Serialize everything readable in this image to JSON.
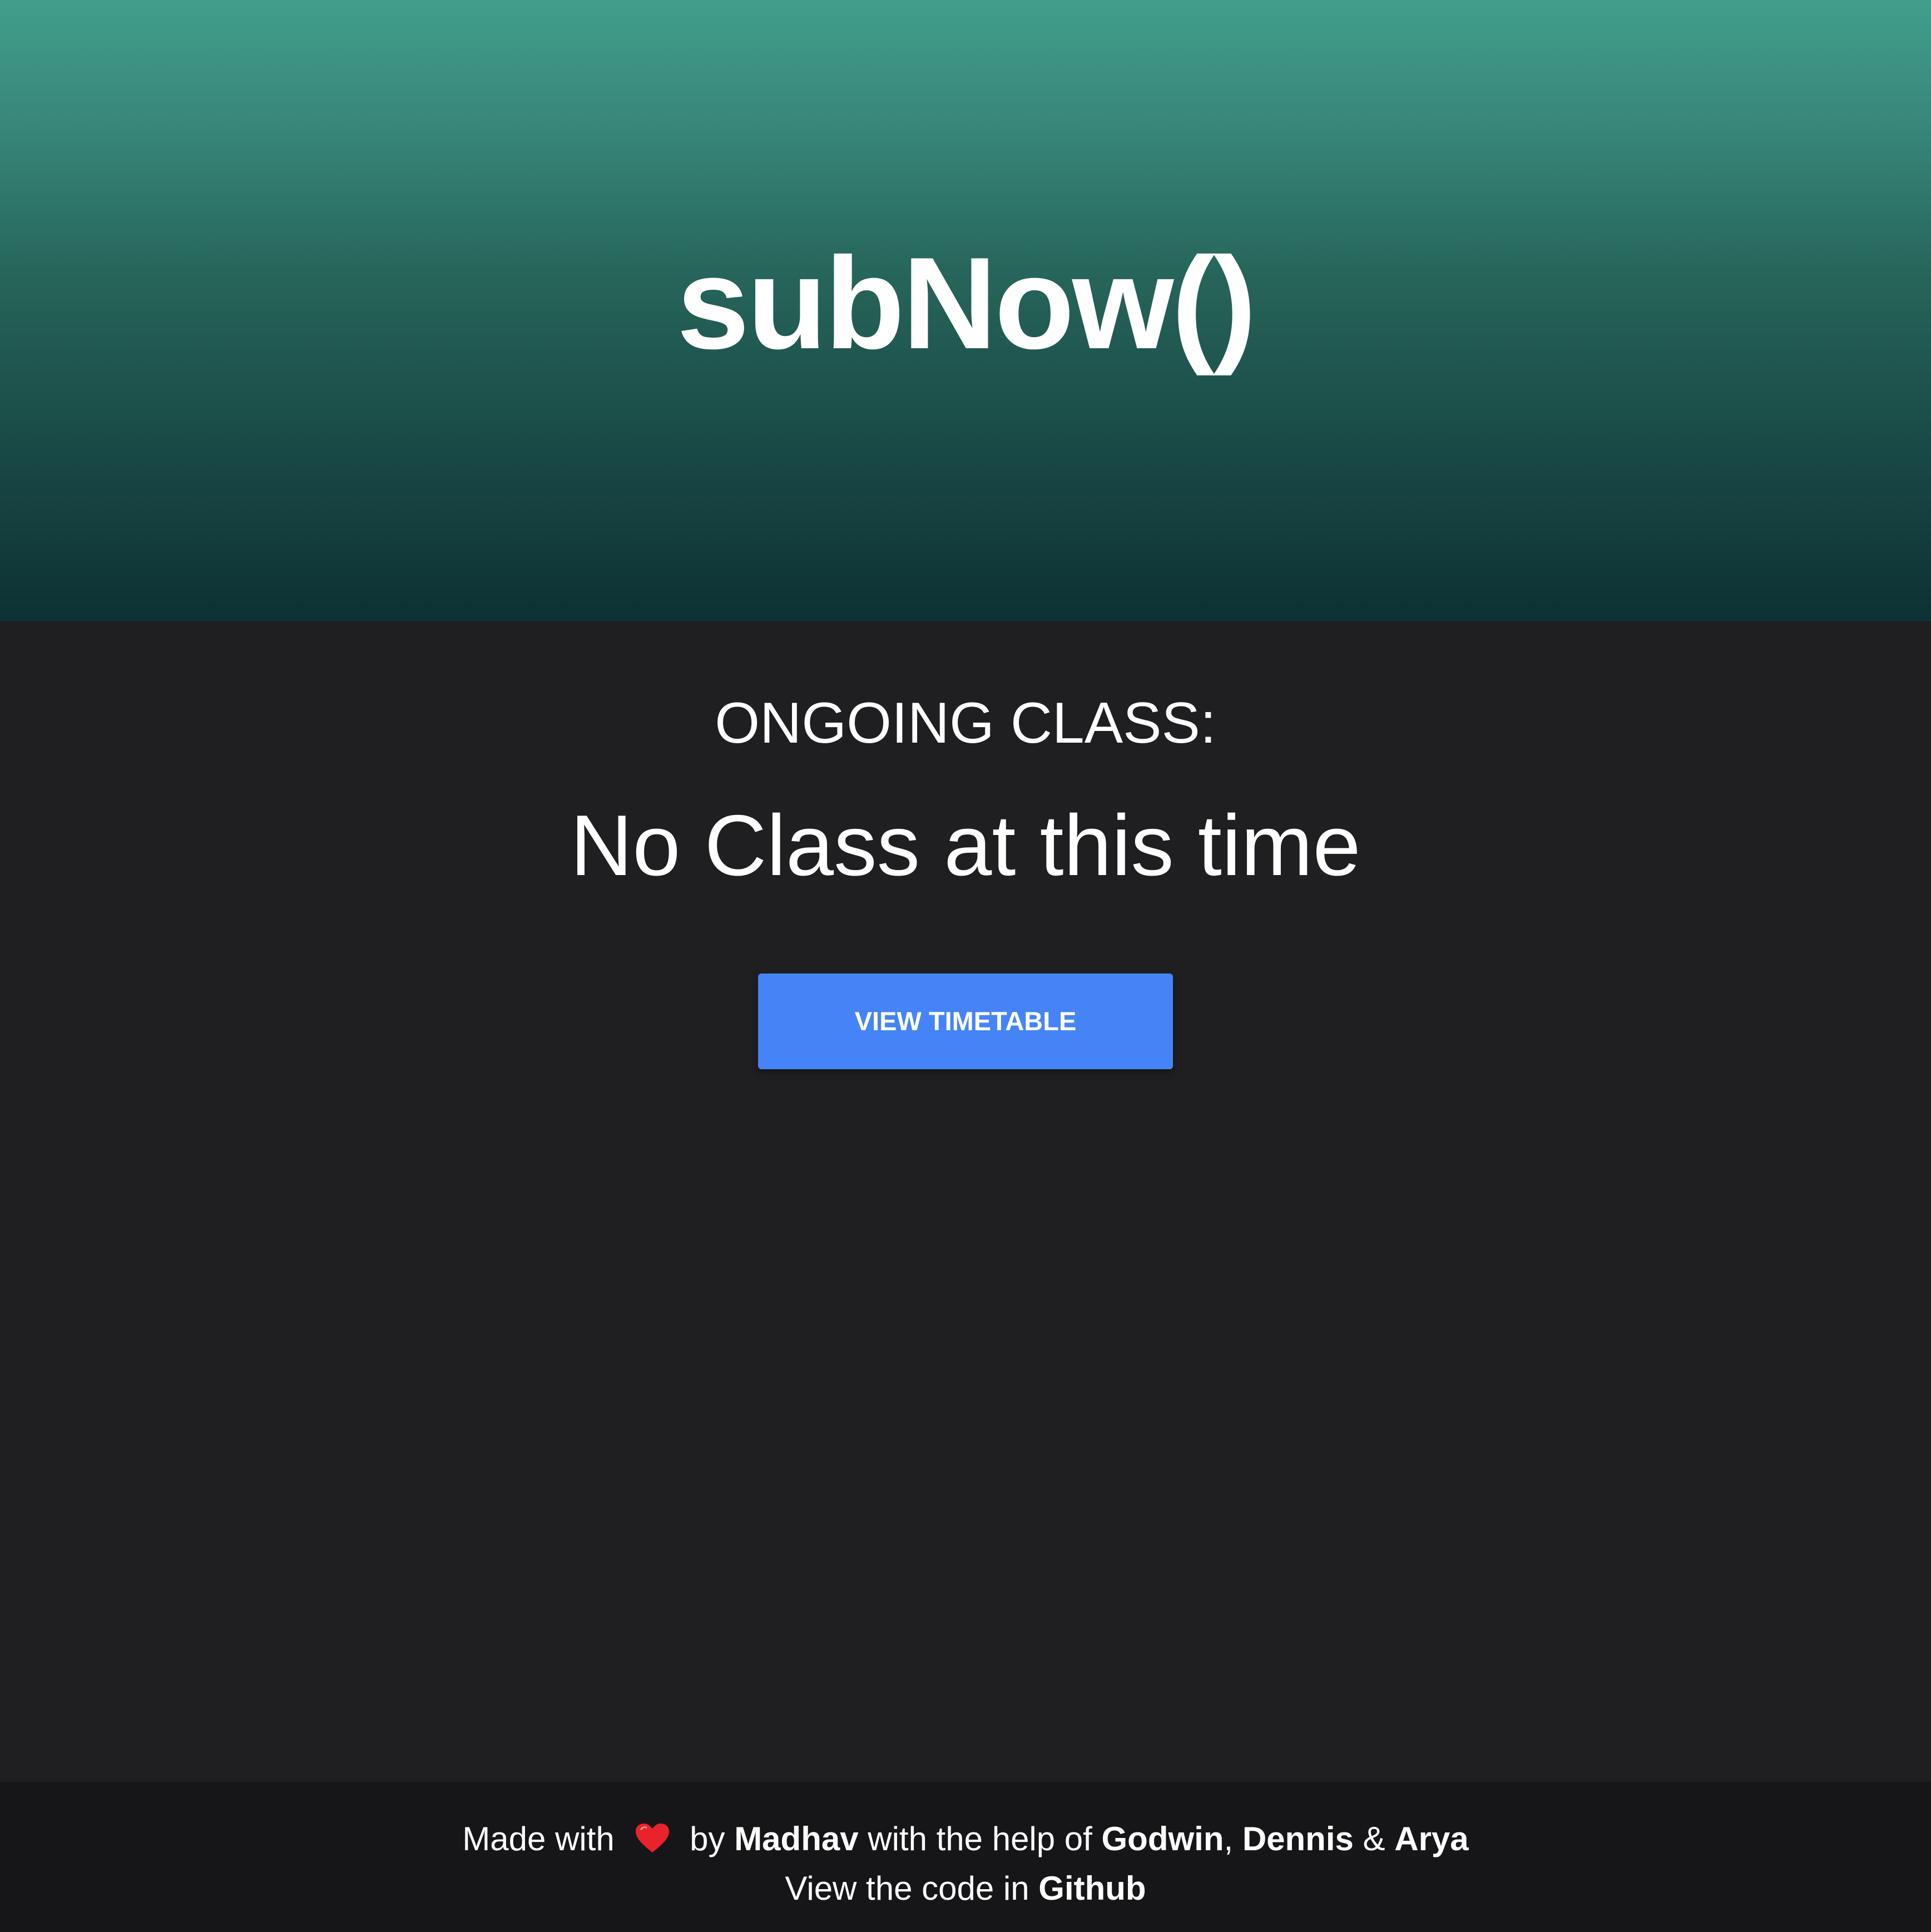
{
  "header": {
    "brand": "subNow()"
  },
  "main": {
    "label": "ONGOING CLASS:",
    "status": "No Class at this time",
    "button_label": "VIEW TIMETABLE"
  },
  "footer": {
    "made_with": "Made with",
    "heart_icon": "heart-icon",
    "by": "by",
    "author": "Madhav",
    "help_text": "with the help of",
    "helper1": "Godwin",
    "comma": ",",
    "helper2": "Dennis",
    "ampersand": "&",
    "helper3": "Arya",
    "code_text": "View the code in",
    "github": "Github"
  },
  "colors": {
    "hero_top": "#429e8b",
    "hero_bottom": "#0d3134",
    "background": "#1f1f21",
    "footer_bg": "#161618",
    "button": "#4584f6",
    "heart": "#e8232c"
  }
}
